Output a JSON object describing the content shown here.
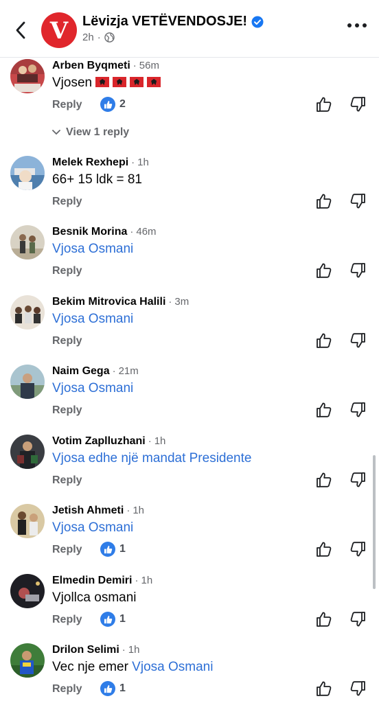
{
  "header": {
    "page_name": "Lëvizja VETËVENDOSJE!",
    "logo_letter": "V",
    "time": "2h",
    "separator": "·",
    "icons": [
      "back-arrow-icon",
      "verified-badge-icon",
      "globe-icon",
      "more-options-icon"
    ]
  },
  "labels": {
    "reply": "Reply"
  },
  "comments": [
    {
      "author": "Arben Byqmeti",
      "time": "56m",
      "text": "Vjosen",
      "flags": 4,
      "likes": "2",
      "view_replies": "View 1 reply"
    },
    {
      "author": "Melek Rexhepi",
      "time": "1h",
      "text": "66+ 15 ldk = 81"
    },
    {
      "author": "Besnik Morina",
      "time": "46m",
      "mention": "Vjosa Osmani"
    },
    {
      "author": "Bekim Mitrovica Halili",
      "time": "3m",
      "mention": "Vjosa Osmani"
    },
    {
      "author": "Naim Gega",
      "time": "21m",
      "mention": "Vjosa Osmani"
    },
    {
      "author": "Votim Zaplluzhani",
      "time": "1h",
      "mention": "Vjosa edhe një mandat Presidente"
    },
    {
      "author": "Jetish Ahmeti",
      "time": "1h",
      "mention": "Vjosa Osmani",
      "likes": "1"
    },
    {
      "author": "Elmedin Demiri",
      "time": "1h",
      "text": "Vjollca osmani",
      "likes": "1"
    },
    {
      "author": "Drilon Selimi",
      "time": "1h",
      "text": "Vec nje emer ",
      "mention": "Vjosa Osmani",
      "likes": "1"
    }
  ],
  "colors": {
    "mention": "#2d6fd6",
    "like_badge": "#2f7de8",
    "logo": "#e0262c",
    "muted": "#65676b"
  }
}
